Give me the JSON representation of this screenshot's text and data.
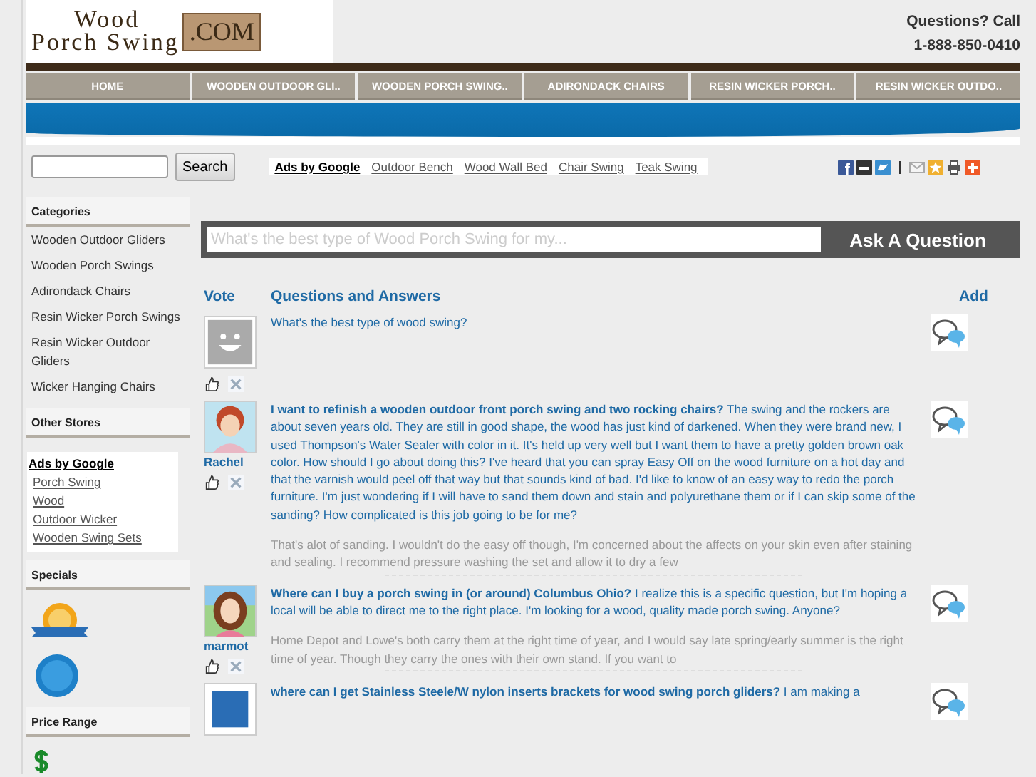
{
  "header": {
    "logo": {
      "line1": "Wood",
      "line2": "Porch Swing",
      "suffix": ".COM"
    },
    "contact": [
      "Questions? Call",
      "1-888-850-0410"
    ]
  },
  "nav": [
    {
      "label": "HOME"
    },
    {
      "label": "WOODEN OUTDOOR GLI.."
    },
    {
      "label": "WOODEN PORCH SWING.."
    },
    {
      "label": "ADIRONDACK CHAIRS"
    },
    {
      "label": "RESIN WICKER PORCH.."
    },
    {
      "label": "RESIN WICKER OUTDO.."
    }
  ],
  "search": {
    "button": "Search"
  },
  "ads": {
    "label": "Ads by Google",
    "links": [
      "Outdoor Bench",
      "Wood Wall Bed",
      "Chair Swing",
      "Teak Swing"
    ]
  },
  "sidebar": [
    {
      "kind": "links",
      "title": "Categories",
      "items": [
        "Wooden Outdoor Gliders",
        "Wooden Porch Swings",
        "Adirondack Chairs",
        "Resin Wicker Porch Swings",
        "Resin Wicker Outdoor Gliders",
        "Wicker Hanging Chairs"
      ]
    },
    {
      "kind": "ads",
      "title": "Other Stores",
      "ads_label": "Ads by Google",
      "items": [
        "Porch Swing",
        "Wood",
        "Outdoor Wicker",
        "Wooden Swing Sets"
      ]
    },
    {
      "kind": "badges",
      "title": "Specials"
    },
    {
      "kind": "price",
      "title": "Price Range"
    }
  ],
  "ask": {
    "placeholder": "What's the best type of Wood Porch Swing for my...",
    "button": "Ask A Question"
  },
  "qa_header": {
    "vote": "Vote",
    "questions": "Questions and Answers",
    "add": "Add"
  },
  "questions": [
    {
      "kind": "default",
      "text": "What's the best type of wood swing?"
    },
    {
      "kind": "redhead",
      "user": "Rachel",
      "text": "**I want to refinish a wooden outdoor front porch swing and two rocking chairs?** The swing and the rockers are about seven years old. They are still in good shape, the wood has just kind of darkened. When they were brand new, I used Thompson's Water Sealer with color in it. It's held up very well but I want them to have a pretty golden brown oak color. How should I go about doing this? I've heard that you can spray Easy Off on the wood furniture on a hot day and that the varnish would peel off that way but that sounds kind of bad. I'd like to know of an easy way to redo the porch furniture. I'm just wondering if I will have to sand them down and stain and polyurethane them or if I can skip some of the sanding? How complicated is this job going to be for me?",
      "answer": "That's alot of sanding. I wouldn't do the easy off though, I'm concerned about the affects on your skin even after staining and sealing. I recommend pressure washing the set and allow it to dry a few"
    },
    {
      "kind": "brunette",
      "user": "marmot",
      "text": "**Where can I buy a porch swing in (or around) Columbus Ohio?** I realize this is a specific question, but I'm hoping a local will be able to direct me to the right place. I'm looking for a wood, quality made porch swing. Anyone?",
      "answer": "Home Depot and Lowe's both carry them at the right time of year, and I would say late spring/early summer is the right time of year. Though they carry the ones with their own stand. If you want to"
    },
    {
      "kind": "unknown",
      "text": "**where can I get Stainless Steele/W nylon inserts brackets for wood swing porch gliders?** I am making a"
    }
  ]
}
